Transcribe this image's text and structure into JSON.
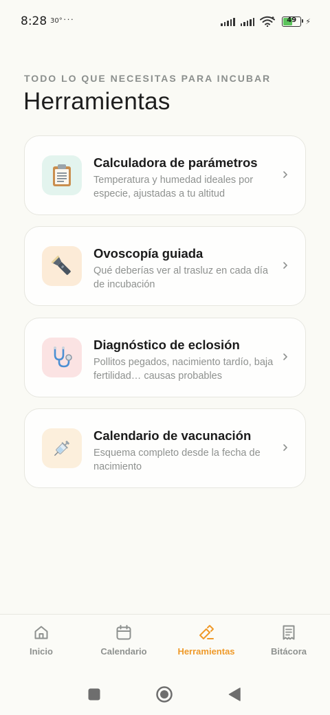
{
  "status_bar": {
    "time": "8:28",
    "temperature": "30°",
    "dots": "···",
    "battery_level": "49",
    "battery_fraction": 0.49
  },
  "header": {
    "overline": "TODO LO QUE NECESITAS PARA INCUBAR",
    "title": "Herramientas"
  },
  "tools": [
    {
      "title": "Calculadora de parámetros",
      "description": "Temperatura y humedad ideales por especie, ajustadas a tu altitud",
      "icon": "clipboard-icon",
      "icon_bg": "#e3f4ee"
    },
    {
      "title": "Ovoscopía guiada",
      "description": "Qué deberías ver al trasluz en cada día de incubación",
      "icon": "flashlight-icon",
      "icon_bg": "#fcebd7"
    },
    {
      "title": "Diagnóstico de eclosión",
      "description": "Pollitos pegados, nacimiento tardío, baja fertilidad… causas probables",
      "icon": "stethoscope-icon",
      "icon_bg": "#fbe3e3"
    },
    {
      "title": "Calendario de vacunación",
      "description": "Esquema completo desde la fecha de nacimiento",
      "icon": "syringe-icon",
      "icon_bg": "#fcefdc"
    }
  ],
  "bottom_nav": {
    "items": [
      {
        "label": "Inicio",
        "icon": "home-icon"
      },
      {
        "label": "Calendario",
        "icon": "calendar-icon"
      },
      {
        "label": "Herramientas",
        "icon": "tools-icon",
        "active": true
      },
      {
        "label": "Bitácora",
        "icon": "receipt-icon"
      }
    ],
    "active_color": "#ef9a2a",
    "inactive_color": "#8e918f"
  },
  "system_nav": {
    "buttons": [
      "recent-apps",
      "home",
      "back"
    ]
  }
}
